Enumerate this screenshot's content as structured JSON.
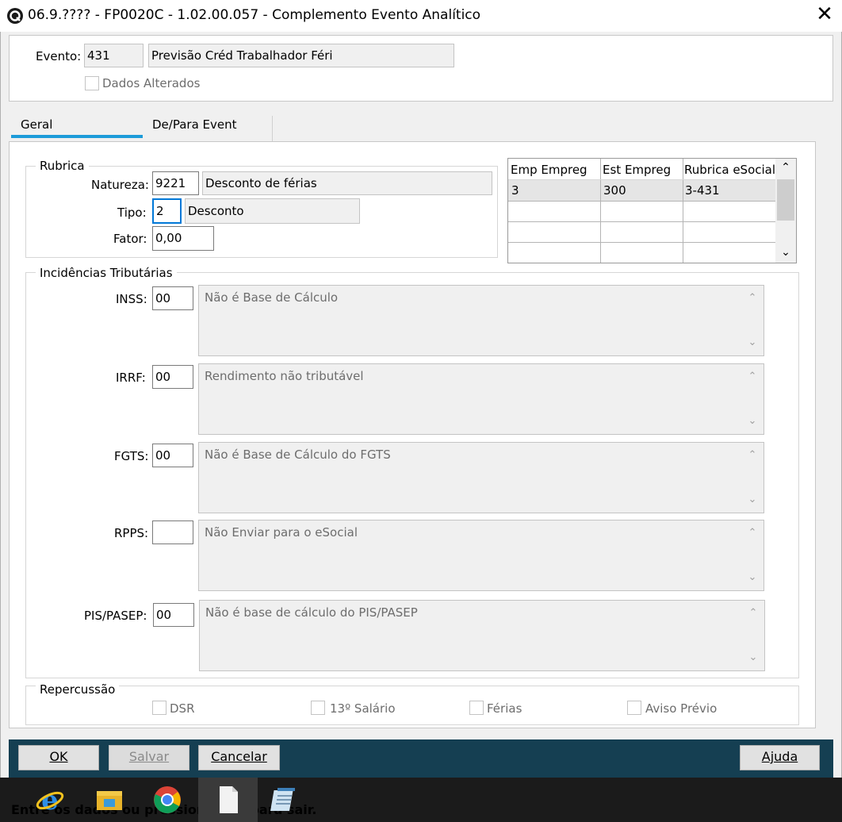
{
  "window": {
    "title": "06.9.???? - FP0020C - 1.02.00.057 - Complemento Evento Analítico",
    "close_glyph": "✕"
  },
  "header": {
    "evento_label": "Evento:",
    "evento_code": "431",
    "evento_desc": "Previsão Créd Trabalhador Féri",
    "dados_alterados_label": "Dados Alterados"
  },
  "tabs": [
    {
      "label": "Geral",
      "active": true
    },
    {
      "label": "De/Para Event",
      "active": false
    }
  ],
  "rubrica": {
    "title": "Rubrica",
    "natureza_label": "Natureza:",
    "natureza_code": "9221",
    "natureza_desc": "Desconto de férias",
    "tipo_label": "Tipo:",
    "tipo_code": "2",
    "tipo_desc": "Desconto",
    "fator_label": "Fator:",
    "fator_value": "0,00"
  },
  "grid": {
    "columns": [
      "Emp Empreg",
      "Est Empreg",
      "Rubrica eSocial"
    ],
    "rows": [
      [
        "3",
        "300",
        "3-431"
      ],
      [
        "",
        "",
        ""
      ],
      [
        "",
        "",
        ""
      ],
      [
        "",
        "",
        ""
      ]
    ]
  },
  "incidencias": {
    "title": "Incidências Tributárias",
    "items": [
      {
        "label": "INSS:",
        "code": "00",
        "desc": "Não é Base de Cálculo"
      },
      {
        "label": "IRRF:",
        "code": "00",
        "desc": "Rendimento não tributável"
      },
      {
        "label": "FGTS:",
        "code": "00",
        "desc": "Não é Base de Cálculo do FGTS"
      },
      {
        "label": "RPPS:",
        "code": "",
        "desc": "Não Enviar para o eSocial"
      },
      {
        "label": "PIS/PASEP:",
        "code": "00",
        "desc": "Não é base de cálculo do PIS/PASEP"
      }
    ]
  },
  "repercussao": {
    "title": "Repercussão",
    "items": [
      "DSR",
      "13º Salário",
      "Férias",
      "Aviso Prévio"
    ]
  },
  "buttons": {
    "ok": "OK",
    "salvar": "Salvar",
    "cancelar": "Cancelar",
    "ajuda": "Ajuda"
  },
  "status_bar_text": "Entre os dados ou pressione ESC para sair.",
  "colors": {
    "accent_tab": "#1c9bd9",
    "button_bar": "#153f52",
    "taskbar": "#1b1b1b",
    "grid_selected_row": "#e5e5e5"
  }
}
